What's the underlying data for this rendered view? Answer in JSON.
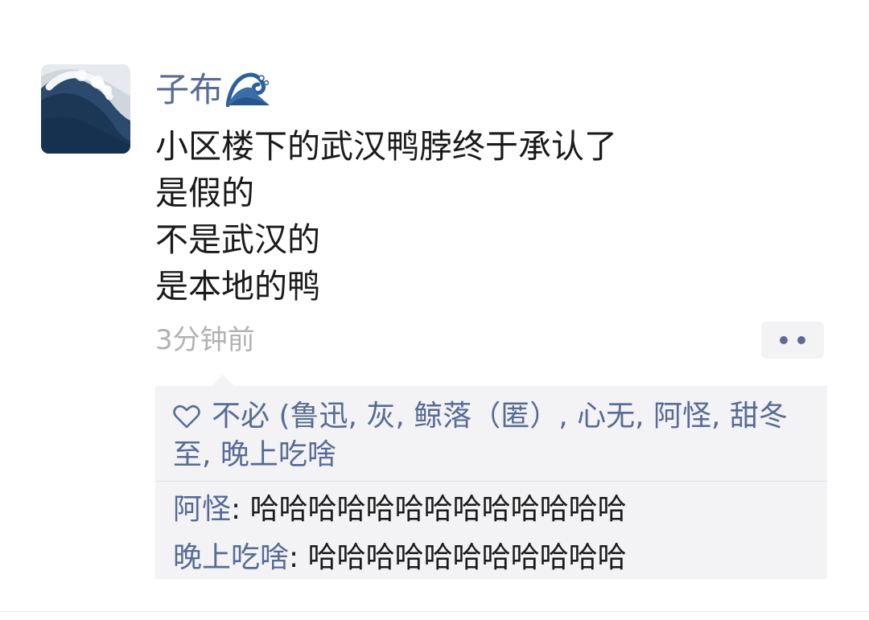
{
  "post": {
    "author": "子布",
    "author_emoji": "wave-emoji",
    "lines": [
      "小区楼下的武汉鸭脖终于承认了",
      "是假的",
      "不是武汉的",
      "是本地的鸭"
    ],
    "timestamp": "3分钟前",
    "more_icon": "more-dots-icon"
  },
  "likes": {
    "icon": "heart-outline-icon",
    "names": "不必 (鲁迅, 灰, 鲸落（匿）, 心无, 阿怪, 甜冬至, 晚上吃啥"
  },
  "comments": [
    {
      "author": "阿怪",
      "separator": ": ",
      "text": "哈哈哈哈哈哈哈哈哈哈哈哈哈"
    },
    {
      "author": "晚上吃啥",
      "separator": ": ",
      "text": "哈哈哈哈哈哈哈哈哈哈哈"
    }
  ],
  "colors": {
    "link_blue": "#576b95",
    "text": "#1a1a1a",
    "muted": "#b2b2b2",
    "panel_bg": "#f3f3f5"
  }
}
